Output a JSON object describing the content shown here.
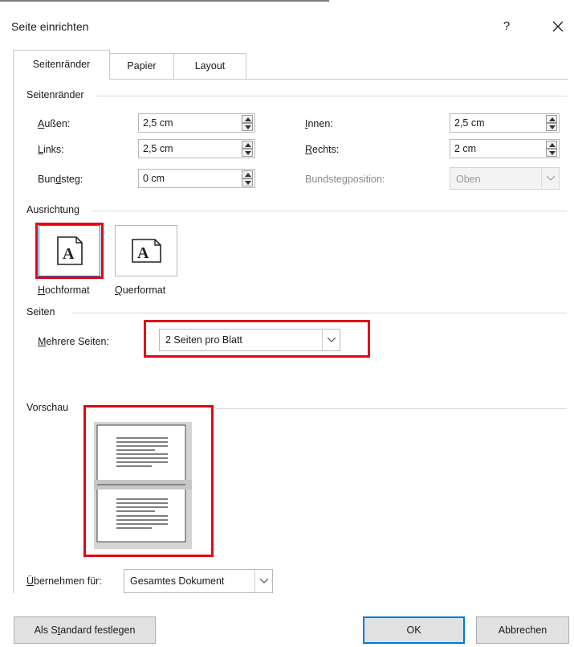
{
  "dialog": {
    "title": "Seite einrichten",
    "help_label": "?"
  },
  "tabs": [
    {
      "label": "Seitenränder",
      "active": true
    },
    {
      "label": "Papier",
      "active": false
    },
    {
      "label": "Layout",
      "active": false
    }
  ],
  "margins": {
    "section_label": "Seitenränder",
    "outer": {
      "label_pre": "A",
      "label_rest": "ußen:",
      "value": "2,5 cm"
    },
    "left": {
      "label_pre": "L",
      "label_rest": "inks:",
      "value": "2,5 cm"
    },
    "gutter": {
      "label_pre": "Bun",
      "label_ul": "d",
      "label_rest": "steg:",
      "value": "0 cm"
    },
    "inner": {
      "label_pre": "I",
      "label_rest": "nnen:",
      "value": "2,5 cm"
    },
    "right": {
      "label_pre": "R",
      "label_rest": "echts:",
      "value": "2 cm"
    },
    "gutter_position": {
      "label": "Bundstegposition:",
      "value": "Oben"
    }
  },
  "orientation": {
    "section_label": "Ausrichtung",
    "portrait": {
      "label_pre": "H",
      "label_rest": "ochformat",
      "selected": true
    },
    "landscape": {
      "label_pre": "Q",
      "label_rest": "uerformat",
      "selected": false
    }
  },
  "pages": {
    "section_label": "Seiten",
    "multiple_label_pre": "M",
    "multiple_label_rest": "ehrere Seiten:",
    "multiple_value": "2 Seiten pro Blatt"
  },
  "preview": {
    "section_label": "Vorschau"
  },
  "apply": {
    "label_pre": "Ü",
    "label_rest": "bernehmen für:",
    "value": "Gesamtes Dokument"
  },
  "buttons": {
    "default_pre": "Als S",
    "default_ul": "t",
    "default_rest": "andard festlegen",
    "ok": "OK",
    "cancel": "Abbrechen"
  },
  "colors": {
    "highlight": "#e30613",
    "focus": "#0078d7"
  }
}
